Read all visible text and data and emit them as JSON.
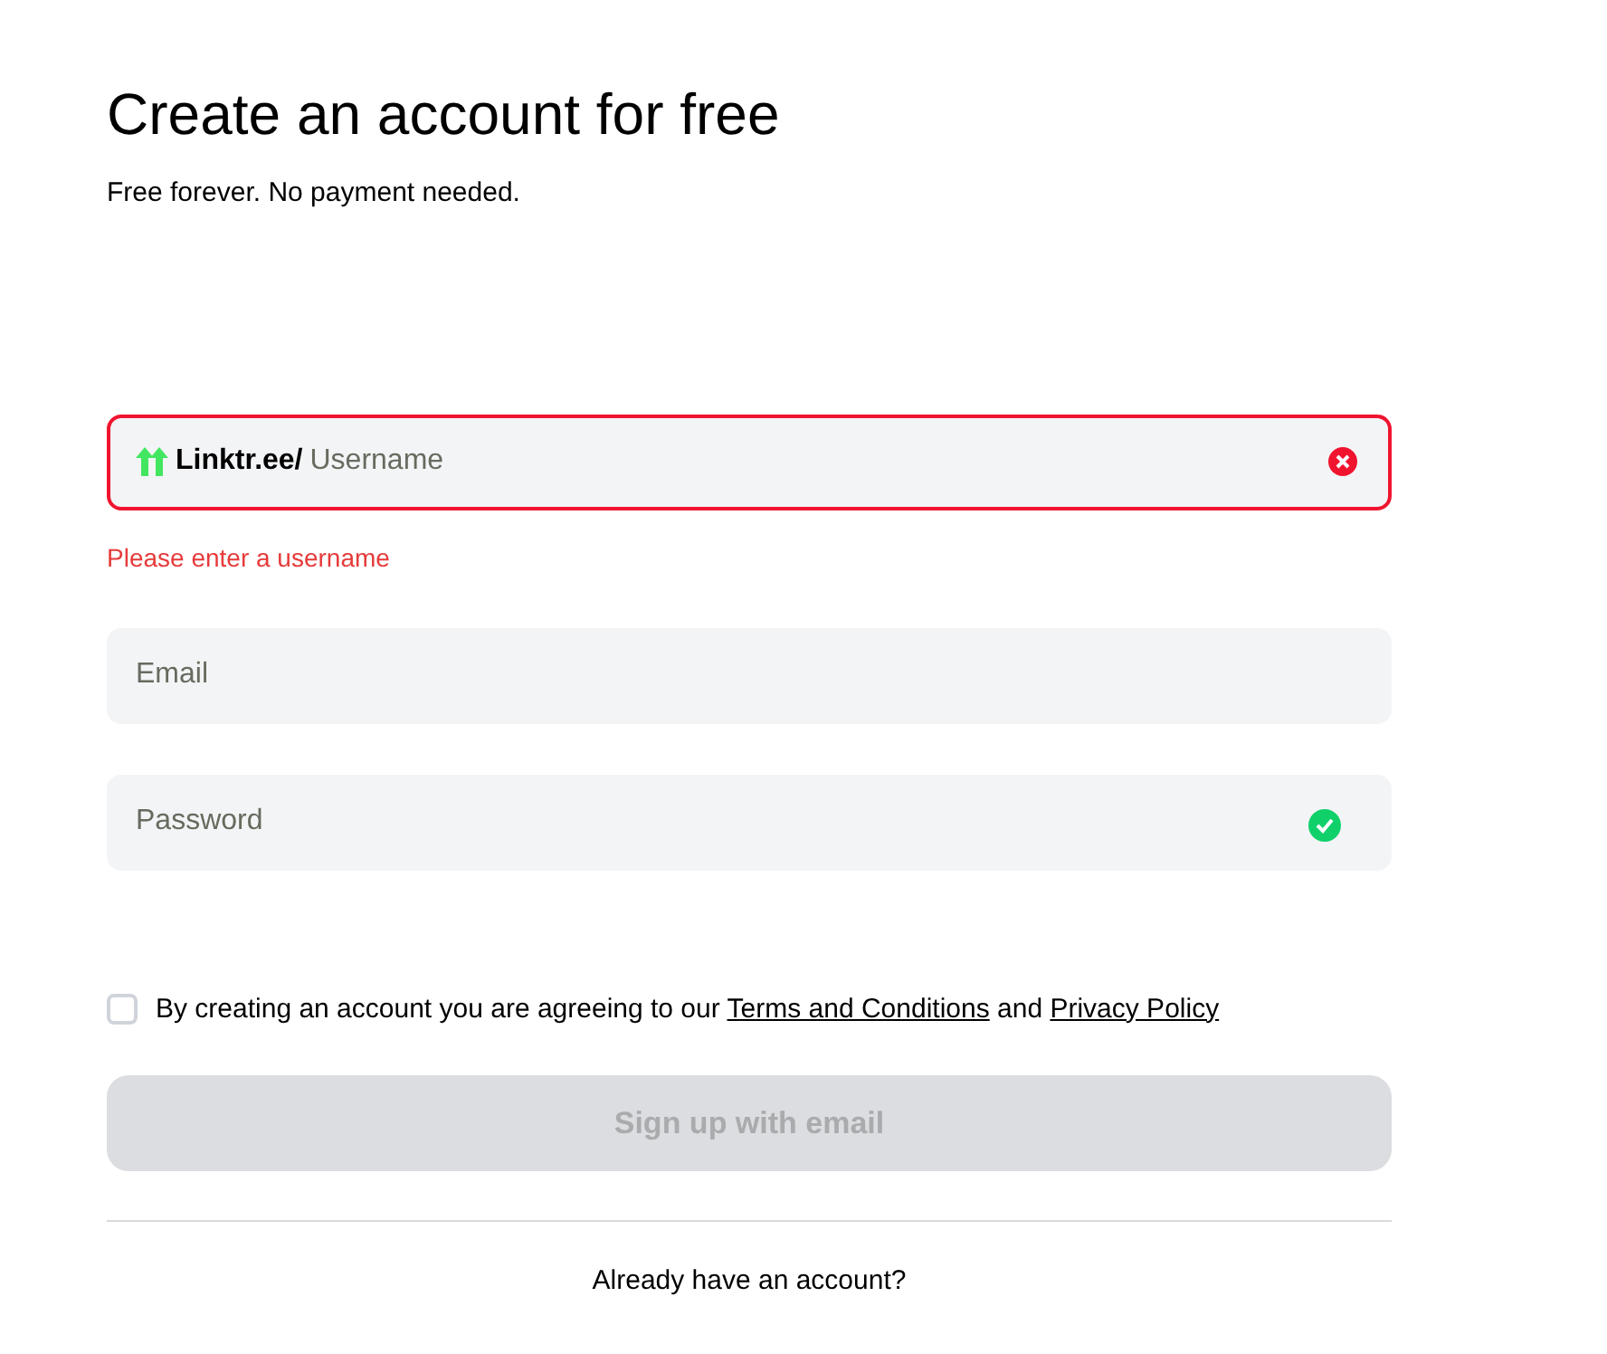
{
  "title": "Create an account for free",
  "subtitle": "Free forever. No payment needed.",
  "fields": [
    {
      "kind": "username",
      "prefix": "Linktr.ee/",
      "placeholder": "Username",
      "invalid": true,
      "valid": false,
      "error": "Please enter a username"
    },
    {
      "kind": "text",
      "placeholder": "Email",
      "invalid": false,
      "valid": false
    },
    {
      "kind": "text",
      "placeholder": "Password",
      "invalid": false,
      "valid": true
    }
  ],
  "agreement": {
    "checked": false,
    "before": "By creating an account you are agreeing to our ",
    "terms": "Terms and Conditions",
    "middle": " and ",
    "privacy": "Privacy Policy"
  },
  "submit": {
    "label": "Sign up with email",
    "disabled": true
  },
  "footer": "Already have an account?"
}
